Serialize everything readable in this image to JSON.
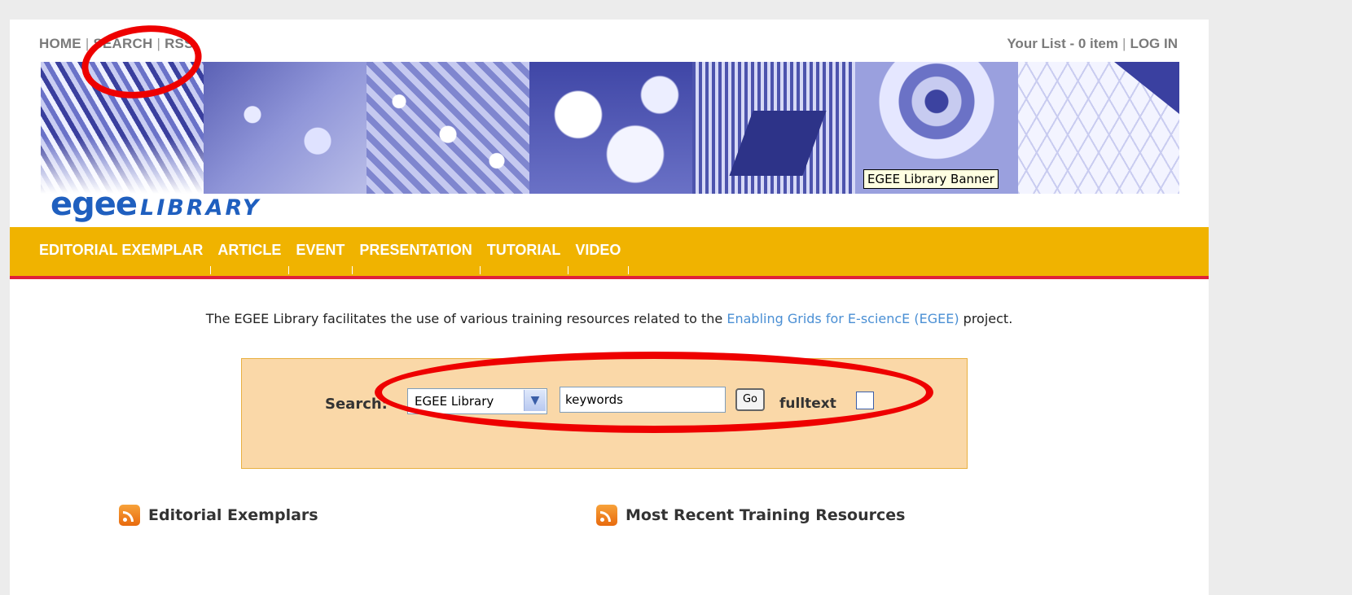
{
  "topnav": {
    "home": "HOME",
    "search": "SEARCH",
    "rss": "RSS"
  },
  "toplinks": {
    "your_list": "Your List - 0 item",
    "login": "LOG IN"
  },
  "banner": {
    "logo_egee": "egee",
    "logo_library": "LIBRARY",
    "tooltip": "EGEE Library Banner"
  },
  "menu": [
    "EDITORIAL EXEMPLAR",
    "ARTICLE",
    "EVENT",
    "PRESENTATION",
    "TUTORIAL",
    "VIDEO"
  ],
  "intro": {
    "before": "The EGEE Library facilitates the use of various training resources related to the ",
    "link": "Enabling Grids for E-sciencE (EGEE)",
    "after": " project."
  },
  "search": {
    "label": "Search:",
    "scope_selected": "EGEE Library",
    "keywords_value": "keywords",
    "go_label": "Go",
    "fulltext_label": "fulltext"
  },
  "sections": {
    "editorial": "Editorial Exemplars",
    "recent": "Most Recent Training Resources"
  },
  "colors": {
    "menu_bg": "#f0b300",
    "menu_underline": "#e0203a",
    "search_bg": "#fad8a8",
    "annotation": "#ee0000",
    "link": "#4a8fd4"
  }
}
